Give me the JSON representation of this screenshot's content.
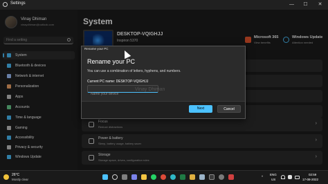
{
  "window": {
    "title": "Settings",
    "minimize": "—",
    "maximize": "☐",
    "close": "✕"
  },
  "user": {
    "name": "Vinay Dhiman",
    "email": "vinaydhiman@outlook.com"
  },
  "search": {
    "placeholder": "Find a setting"
  },
  "nav": [
    {
      "label": "System",
      "icon": "monitor-icon",
      "color": "#4cc2ff",
      "active": true
    },
    {
      "label": "Bluetooth & devices",
      "icon": "bluetooth-icon",
      "color": "#4cc2ff"
    },
    {
      "label": "Network & internet",
      "icon": "wifi-icon",
      "color": "#a0c4ff"
    },
    {
      "label": "Personalization",
      "icon": "brush-icon",
      "color": "#f4a86a"
    },
    {
      "label": "Apps",
      "icon": "apps-icon",
      "color": "#c8c8c8"
    },
    {
      "label": "Accounts",
      "icon": "person-icon",
      "color": "#6ad08f"
    },
    {
      "label": "Time & language",
      "icon": "globe-clock-icon",
      "color": "#4cc2ff"
    },
    {
      "label": "Gaming",
      "icon": "gamepad-icon",
      "color": "#c8c8c8"
    },
    {
      "label": "Accessibility",
      "icon": "accessibility-icon",
      "color": "#4cc2ff"
    },
    {
      "label": "Privacy & security",
      "icon": "shield-icon",
      "color": "#c8c8c8"
    },
    {
      "label": "Windows Update",
      "icon": "update-icon",
      "color": "#4cc2ff"
    }
  ],
  "main": {
    "title": "System",
    "pc_name": "DESKTOP-VQIGHJJ",
    "pc_model": "Inspiron 5370",
    "quick": [
      {
        "label": "Microsoft 365",
        "sub": "View benefits",
        "icon": "m365-icon",
        "color": "#e6552d"
      },
      {
        "label": "Windows Update",
        "sub": "Attention needed",
        "icon": "update-icon",
        "color": "#4cc2ff"
      }
    ],
    "cards": [
      {
        "title": "Focus",
        "sub": "Reduce distractions",
        "icon": "focus-icon"
      },
      {
        "title": "Power & battery",
        "sub": "Sleep, battery usage, battery saver",
        "icon": "power-icon"
      },
      {
        "title": "Storage",
        "sub": "Storage space, drives, configuration rules",
        "icon": "storage-icon"
      }
    ]
  },
  "dialog": {
    "window_title": "Rename your PC",
    "heading": "Rename your PC",
    "description": "You can use a combination of letters, hyphens, and numbers.",
    "current_label": "Current PC name: DESKTOP-VQIGHJJ",
    "input_placeholder": "Name your device",
    "next_label": "Next",
    "cancel_label": "Cancel",
    "watermark": "Vinay Dhiman"
  },
  "taskbar": {
    "weather_temp": "26°C",
    "weather_desc": "Mostly clear",
    "lang_top": "ENG",
    "lang_bottom": "US",
    "time": "02:59",
    "date": "17-08-2022"
  }
}
